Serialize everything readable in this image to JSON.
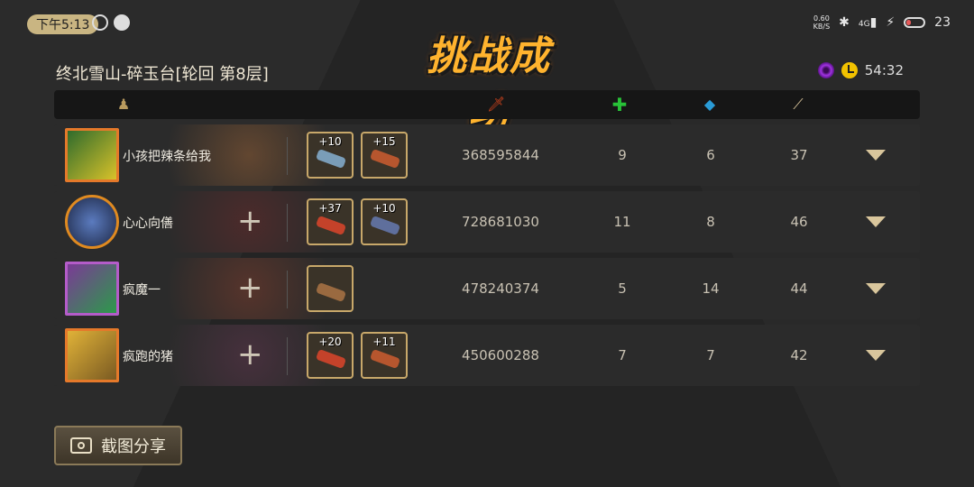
{
  "status_bar": {
    "time": "下午5:13",
    "net_speed_value": "0.60",
    "net_speed_unit": "KB/S",
    "signal": "4G",
    "battery": "23"
  },
  "title": "挑战成功",
  "stage": "终北雪山-碎玉台[轮回 第8层]",
  "timer": "54:32",
  "header_icons": [
    "player-icon",
    "damage-sword-icon",
    "heal-cross-icon",
    "wolf-icon",
    "bone-icon"
  ],
  "colors": {
    "title": "#ffb32e",
    "gold_border": "#c8a86a",
    "heal": "#28c238",
    "wolf": "#2a9bd6",
    "damage": "#d2441c"
  },
  "rows": [
    {
      "name": "小孩把辣条给我",
      "items": [
        {
          "level": "+10"
        },
        {
          "level": "+15"
        }
      ],
      "damage": "368595844",
      "heal": "9",
      "wolf": "6",
      "bone": "37",
      "avatar": "orange"
    },
    {
      "name": "心心向僐",
      "items": [
        {
          "level": "+37"
        },
        {
          "level": "+10"
        }
      ],
      "damage": "728681030",
      "heal": "11",
      "wolf": "8",
      "bone": "46",
      "avatar": "blue"
    },
    {
      "name": "疯魔一",
      "items": [
        {
          "level": ""
        }
      ],
      "damage": "478240374",
      "heal": "5",
      "wolf": "14",
      "bone": "44",
      "avatar": "purple"
    },
    {
      "name": "疯跑的猪",
      "items": [
        {
          "level": "+20"
        },
        {
          "level": "+11"
        }
      ],
      "damage": "450600288",
      "heal": "7",
      "wolf": "7",
      "bone": "42",
      "avatar": "orange"
    }
  ],
  "share_button": "截图分享"
}
